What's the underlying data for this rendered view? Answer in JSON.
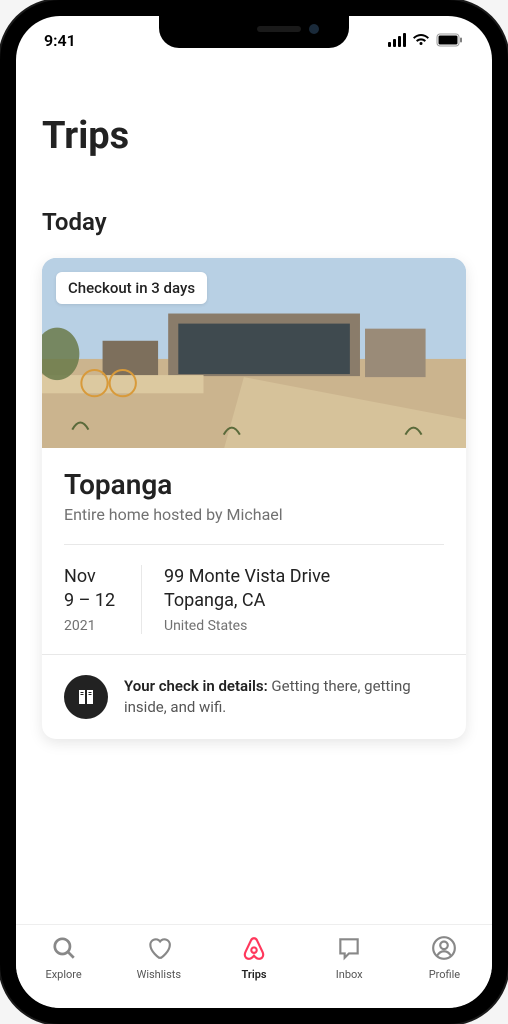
{
  "status": {
    "time": "9:41"
  },
  "page": {
    "title": "Trips"
  },
  "section": {
    "title": "Today"
  },
  "trip": {
    "badge": "Checkout in 3 days",
    "location": "Topanga",
    "host": "Entire home hosted by Michael",
    "dates": {
      "month": "Nov",
      "range": "9 – 12",
      "year": "2021"
    },
    "address": {
      "line1": "99 Monte Vista Drive",
      "line2": "Topanga, CA",
      "country": "United States"
    },
    "checkin": {
      "label": "Your check in details:",
      "detail": " Getting there, getting inside, and wifi."
    }
  },
  "tabs": {
    "explore": "Explore",
    "wishlists": "Wishlists",
    "trips": "Trips",
    "inbox": "Inbox",
    "profile": "Profile"
  }
}
